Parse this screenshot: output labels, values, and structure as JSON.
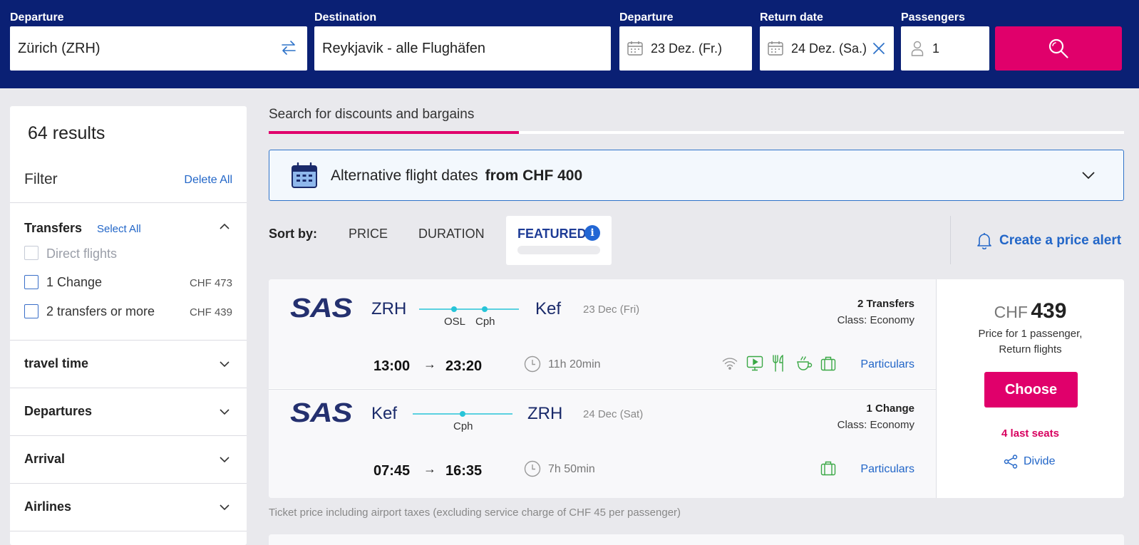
{
  "search": {
    "departure_label": "Departure",
    "departure_value": "Zürich (ZRH)",
    "destination_label": "Destination",
    "destination_value": "Reykjavik - alle Flughäfen",
    "depdate_label": "Departure",
    "depdate_value": "23 Dez. (Fr.)",
    "retdate_label": "Return date",
    "retdate_value": "24 Dez. (Sa.)",
    "passengers_label": "Passengers",
    "passengers_value": "1",
    "accent": "#e0006b",
    "header_color": "#0a2074"
  },
  "sidebar": {
    "results": "64 results",
    "filter": "Filter",
    "delete_all": "Delete All",
    "transfers": {
      "title": "Transfers",
      "select_all": "Select All",
      "options": [
        {
          "label": "Direct flights",
          "price": ""
        },
        {
          "label": "1 Change",
          "price": "CHF 473"
        },
        {
          "label": "2 transfers or more",
          "price": "CHF 439"
        }
      ]
    },
    "sections": [
      "travel time",
      "Departures",
      "Arrival",
      "Airlines"
    ]
  },
  "main": {
    "tab": "Search for discounts and bargains",
    "alt_dates": {
      "label": "Alternative flight dates",
      "price": "from CHF 400"
    },
    "sort": {
      "label": "Sort by:",
      "price": "PRICE",
      "duration": "DURATION",
      "featured": "FEATURED",
      "info": "i"
    },
    "price_alert": "Create a price alert",
    "flight": {
      "outbound": {
        "airline": "SAS",
        "from": "ZRH",
        "to": "Kef",
        "stops": [
          "OSL",
          "Cph"
        ],
        "date": "23 Dec (Fri)",
        "transfers": "2 Transfers",
        "class": "Class: Economy",
        "dep": "13:00",
        "arrow": "→",
        "arr": "23:20",
        "duration": "11h 20min",
        "amenities": [
          "wifi-icon",
          "video-icon",
          "meal-icon",
          "drink-icon",
          "baggage-icon"
        ],
        "details": "Particulars"
      },
      "inbound": {
        "airline": "SAS",
        "from": "Kef",
        "to": "ZRH",
        "stops": [
          "Cph"
        ],
        "date": "24 Dec (Sat)",
        "transfers": "1 Change",
        "class": "Class: Economy",
        "dep": "07:45",
        "arrow": "→",
        "arr": "16:35",
        "duration": "7h 50min",
        "amenities": [
          "baggage-icon"
        ],
        "details": "Particulars"
      },
      "price_currency": "CHF",
      "price_amount": "439",
      "price_note_1": "Price for 1 passenger,",
      "price_note_2": "Return flights",
      "choose": "Choose",
      "seats": "4 last seats",
      "share": "Divide"
    },
    "footnote": "Ticket price including airport taxes (excluding service charge of CHF 45 per passenger)"
  }
}
